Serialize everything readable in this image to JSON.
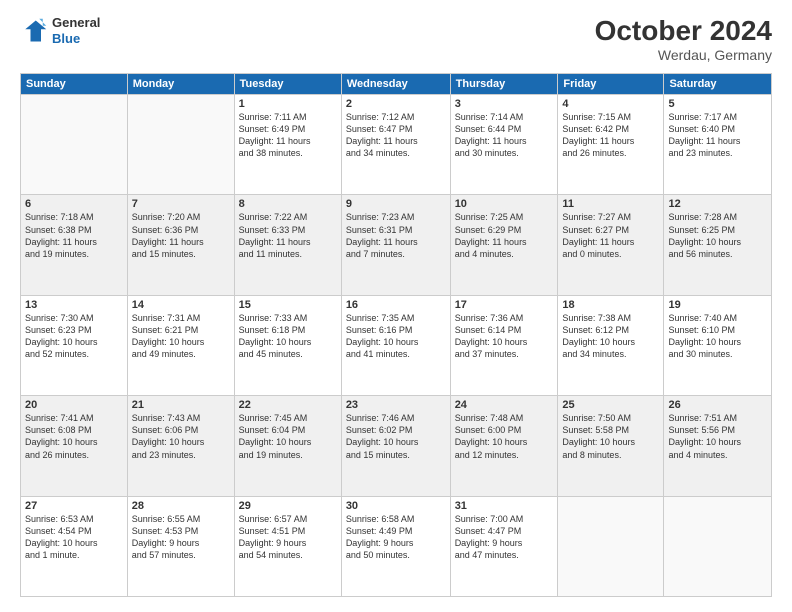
{
  "header": {
    "logo": {
      "general": "General",
      "blue": "Blue"
    },
    "title": "October 2024",
    "location": "Werdau, Germany"
  },
  "weekdays": [
    "Sunday",
    "Monday",
    "Tuesday",
    "Wednesday",
    "Thursday",
    "Friday",
    "Saturday"
  ],
  "weeks": [
    [
      {
        "day": "",
        "info": ""
      },
      {
        "day": "",
        "info": ""
      },
      {
        "day": "1",
        "info": "Sunrise: 7:11 AM\nSunset: 6:49 PM\nDaylight: 11 hours\nand 38 minutes."
      },
      {
        "day": "2",
        "info": "Sunrise: 7:12 AM\nSunset: 6:47 PM\nDaylight: 11 hours\nand 34 minutes."
      },
      {
        "day": "3",
        "info": "Sunrise: 7:14 AM\nSunset: 6:44 PM\nDaylight: 11 hours\nand 30 minutes."
      },
      {
        "day": "4",
        "info": "Sunrise: 7:15 AM\nSunset: 6:42 PM\nDaylight: 11 hours\nand 26 minutes."
      },
      {
        "day": "5",
        "info": "Sunrise: 7:17 AM\nSunset: 6:40 PM\nDaylight: 11 hours\nand 23 minutes."
      }
    ],
    [
      {
        "day": "6",
        "info": "Sunrise: 7:18 AM\nSunset: 6:38 PM\nDaylight: 11 hours\nand 19 minutes."
      },
      {
        "day": "7",
        "info": "Sunrise: 7:20 AM\nSunset: 6:36 PM\nDaylight: 11 hours\nand 15 minutes."
      },
      {
        "day": "8",
        "info": "Sunrise: 7:22 AM\nSunset: 6:33 PM\nDaylight: 11 hours\nand 11 minutes."
      },
      {
        "day": "9",
        "info": "Sunrise: 7:23 AM\nSunset: 6:31 PM\nDaylight: 11 hours\nand 7 minutes."
      },
      {
        "day": "10",
        "info": "Sunrise: 7:25 AM\nSunset: 6:29 PM\nDaylight: 11 hours\nand 4 minutes."
      },
      {
        "day": "11",
        "info": "Sunrise: 7:27 AM\nSunset: 6:27 PM\nDaylight: 11 hours\nand 0 minutes."
      },
      {
        "day": "12",
        "info": "Sunrise: 7:28 AM\nSunset: 6:25 PM\nDaylight: 10 hours\nand 56 minutes."
      }
    ],
    [
      {
        "day": "13",
        "info": "Sunrise: 7:30 AM\nSunset: 6:23 PM\nDaylight: 10 hours\nand 52 minutes."
      },
      {
        "day": "14",
        "info": "Sunrise: 7:31 AM\nSunset: 6:21 PM\nDaylight: 10 hours\nand 49 minutes."
      },
      {
        "day": "15",
        "info": "Sunrise: 7:33 AM\nSunset: 6:18 PM\nDaylight: 10 hours\nand 45 minutes."
      },
      {
        "day": "16",
        "info": "Sunrise: 7:35 AM\nSunset: 6:16 PM\nDaylight: 10 hours\nand 41 minutes."
      },
      {
        "day": "17",
        "info": "Sunrise: 7:36 AM\nSunset: 6:14 PM\nDaylight: 10 hours\nand 37 minutes."
      },
      {
        "day": "18",
        "info": "Sunrise: 7:38 AM\nSunset: 6:12 PM\nDaylight: 10 hours\nand 34 minutes."
      },
      {
        "day": "19",
        "info": "Sunrise: 7:40 AM\nSunset: 6:10 PM\nDaylight: 10 hours\nand 30 minutes."
      }
    ],
    [
      {
        "day": "20",
        "info": "Sunrise: 7:41 AM\nSunset: 6:08 PM\nDaylight: 10 hours\nand 26 minutes."
      },
      {
        "day": "21",
        "info": "Sunrise: 7:43 AM\nSunset: 6:06 PM\nDaylight: 10 hours\nand 23 minutes."
      },
      {
        "day": "22",
        "info": "Sunrise: 7:45 AM\nSunset: 6:04 PM\nDaylight: 10 hours\nand 19 minutes."
      },
      {
        "day": "23",
        "info": "Sunrise: 7:46 AM\nSunset: 6:02 PM\nDaylight: 10 hours\nand 15 minutes."
      },
      {
        "day": "24",
        "info": "Sunrise: 7:48 AM\nSunset: 6:00 PM\nDaylight: 10 hours\nand 12 minutes."
      },
      {
        "day": "25",
        "info": "Sunrise: 7:50 AM\nSunset: 5:58 PM\nDaylight: 10 hours\nand 8 minutes."
      },
      {
        "day": "26",
        "info": "Sunrise: 7:51 AM\nSunset: 5:56 PM\nDaylight: 10 hours\nand 4 minutes."
      }
    ],
    [
      {
        "day": "27",
        "info": "Sunrise: 6:53 AM\nSunset: 4:54 PM\nDaylight: 10 hours\nand 1 minute."
      },
      {
        "day": "28",
        "info": "Sunrise: 6:55 AM\nSunset: 4:53 PM\nDaylight: 9 hours\nand 57 minutes."
      },
      {
        "day": "29",
        "info": "Sunrise: 6:57 AM\nSunset: 4:51 PM\nDaylight: 9 hours\nand 54 minutes."
      },
      {
        "day": "30",
        "info": "Sunrise: 6:58 AM\nSunset: 4:49 PM\nDaylight: 9 hours\nand 50 minutes."
      },
      {
        "day": "31",
        "info": "Sunrise: 7:00 AM\nSunset: 4:47 PM\nDaylight: 9 hours\nand 47 minutes."
      },
      {
        "day": "",
        "info": ""
      },
      {
        "day": "",
        "info": ""
      }
    ]
  ]
}
